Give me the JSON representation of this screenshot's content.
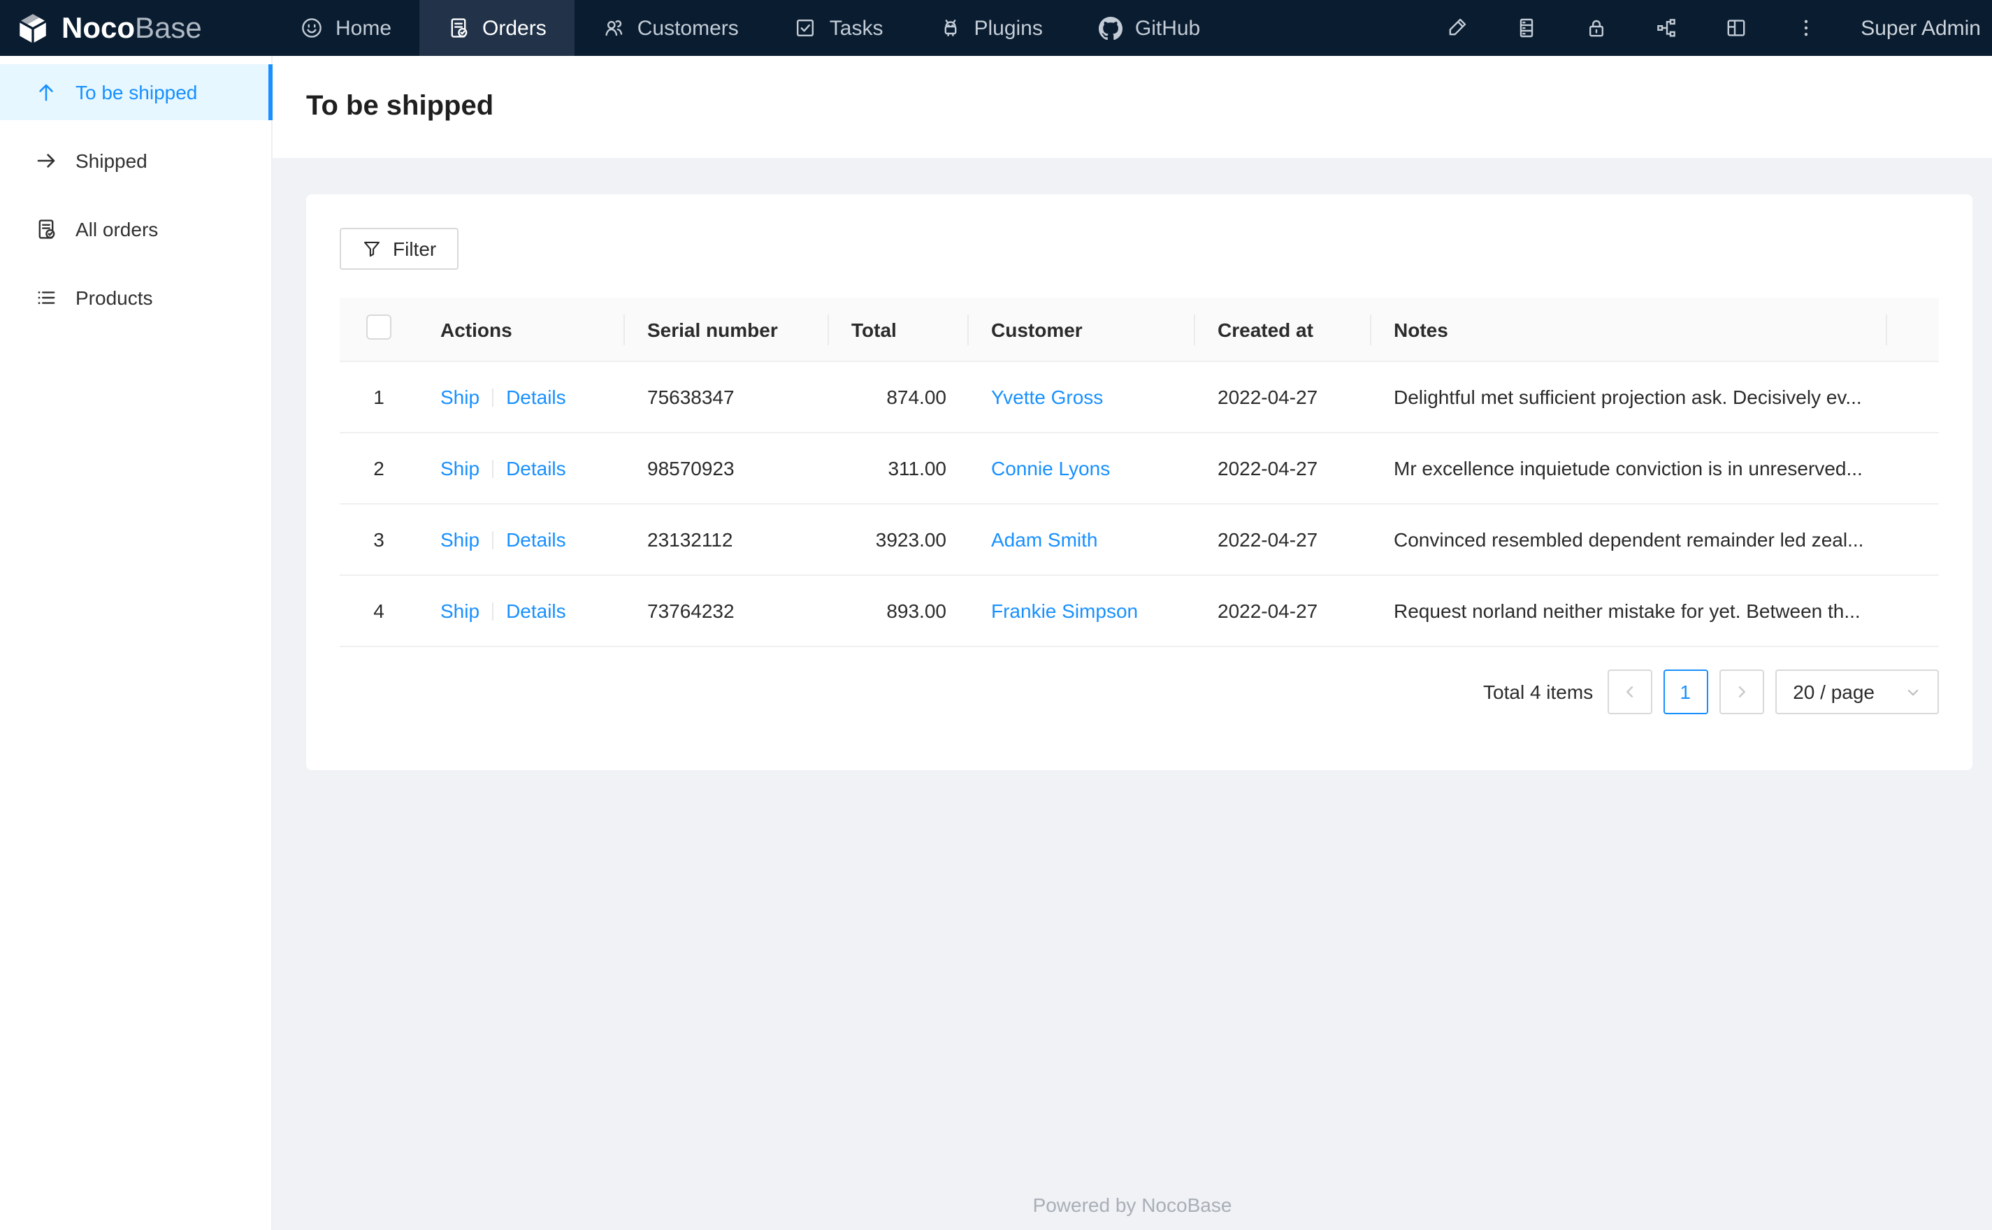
{
  "topnav": {
    "logo": {
      "text_primary": "Noco",
      "text_secondary": "Base"
    },
    "items": [
      {
        "label": "Home",
        "icon": "smile-icon",
        "active": false
      },
      {
        "label": "Orders",
        "icon": "file-done-icon",
        "active": true
      },
      {
        "label": "Customers",
        "icon": "team-icon",
        "active": false
      },
      {
        "label": "Tasks",
        "icon": "check-square-icon",
        "active": false
      },
      {
        "label": "Plugins",
        "icon": "robot-icon",
        "active": false
      },
      {
        "label": "GitHub",
        "icon": "github-icon",
        "active": false
      }
    ],
    "action_icons": [
      "highlighter-icon",
      "database-icon",
      "lock-icon",
      "apartment-icon",
      "layout-icon",
      "ellipsis-vertical-icon"
    ],
    "user": "Super Admin"
  },
  "sidebar": {
    "items": [
      {
        "label": "To be shipped",
        "icon": "arrow-up-icon",
        "active": true
      },
      {
        "label": "Shipped",
        "icon": "arrow-right-icon",
        "active": false
      },
      {
        "label": "All orders",
        "icon": "file-done-icon",
        "active": false
      },
      {
        "label": "Products",
        "icon": "unordered-list-icon",
        "active": false
      }
    ]
  },
  "page": {
    "title": "To be shipped"
  },
  "toolbar": {
    "filter_label": "Filter"
  },
  "table": {
    "columns": [
      "Actions",
      "Serial number",
      "Total",
      "Customer",
      "Created at",
      "Notes"
    ],
    "rows": [
      {
        "index": "1",
        "actions": [
          "Ship",
          "Details"
        ],
        "serial": "75638347",
        "total": "874.00",
        "customer": "Yvette Gross",
        "created_at": "2022-04-27",
        "notes": "Delightful met sufficient projection ask. Decisively ev..."
      },
      {
        "index": "2",
        "actions": [
          "Ship",
          "Details"
        ],
        "serial": "98570923",
        "total": "311.00",
        "customer": "Connie Lyons",
        "created_at": "2022-04-27",
        "notes": "Mr excellence inquietude conviction is in unreserved..."
      },
      {
        "index": "3",
        "actions": [
          "Ship",
          "Details"
        ],
        "serial": "23132112",
        "total": "3923.00",
        "customer": "Adam Smith",
        "created_at": "2022-04-27",
        "notes": "Convinced resembled dependent remainder led zeal..."
      },
      {
        "index": "4",
        "actions": [
          "Ship",
          "Details"
        ],
        "serial": "73764232",
        "total": "893.00",
        "customer": "Frankie Simpson",
        "created_at": "2022-04-27",
        "notes": "Request norland neither mistake for yet. Between th..."
      }
    ]
  },
  "pagination": {
    "total_text": "Total 4 items",
    "prev_label": "previous page",
    "current_page": "1",
    "next_label": "next page",
    "page_size": "20 / page"
  },
  "footer": {
    "text": "Powered by NocoBase"
  },
  "colors": {
    "primary": "#1890ff",
    "nav_bg": "#0a1c30",
    "nav_active_bg": "#223349",
    "sidebar_active_bg": "#e6f7ff",
    "content_bg": "#f0f2f5",
    "table_header_bg": "#fafafa",
    "border": "#f0f0f0"
  }
}
